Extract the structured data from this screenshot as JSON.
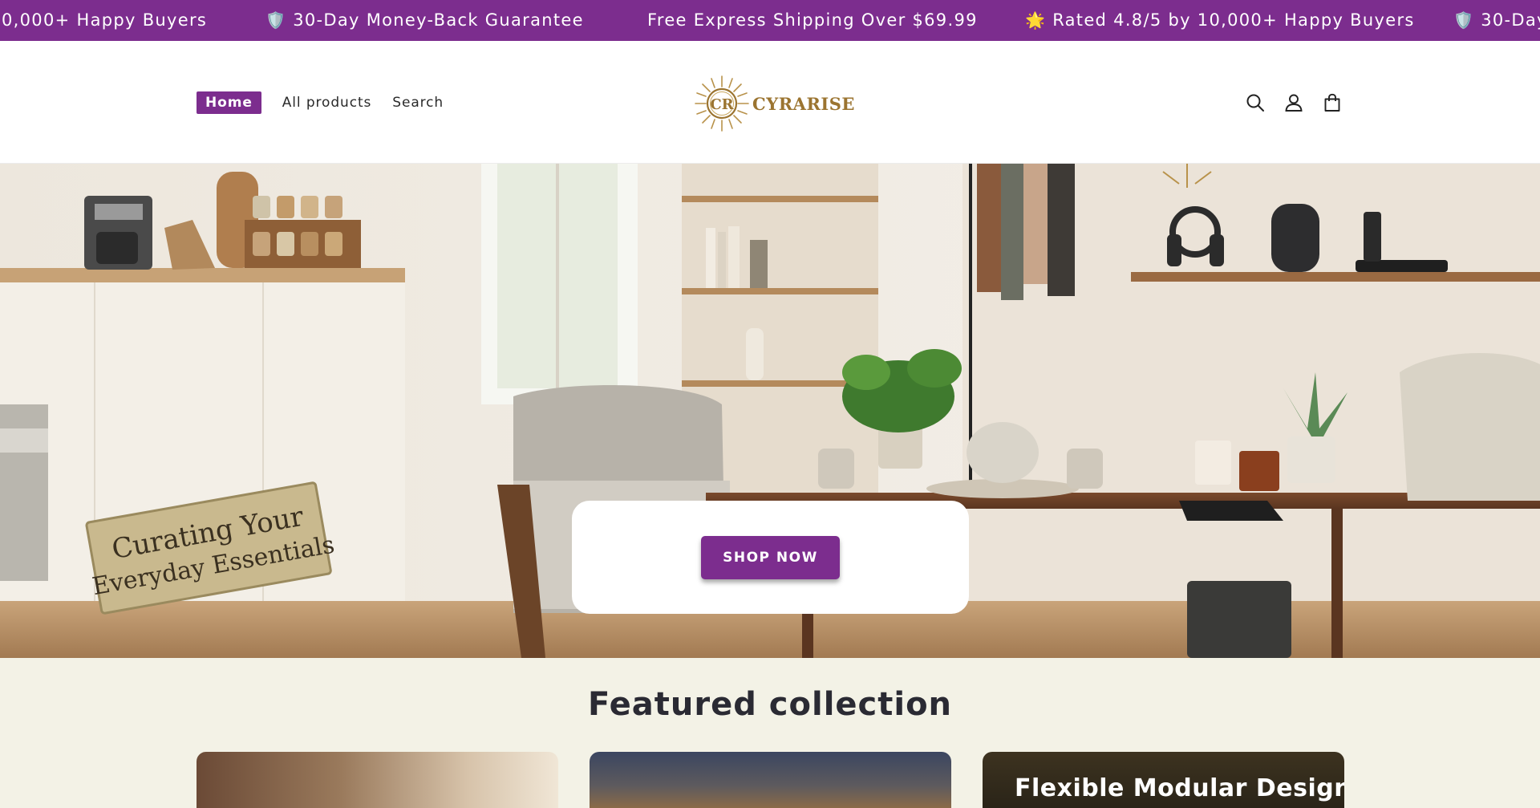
{
  "announcement": {
    "messages": [
      {
        "emoji": "",
        "text": "0,000+ Happy Buyers"
      },
      {
        "emoji": "🛡️",
        "text": "30-Day Money-Back Guarantee"
      },
      {
        "emoji": "",
        "text": "Free Express Shipping Over $69.99"
      },
      {
        "emoji": "🌟",
        "text": "Rated 4.8/5 by 10,000+ Happy Buyers"
      },
      {
        "emoji": "🛡️",
        "text": "30-Day"
      }
    ]
  },
  "header": {
    "nav": [
      {
        "label": "Home"
      },
      {
        "label": "All products"
      },
      {
        "label": "Search"
      }
    ],
    "logo": {
      "text": "CYRARISE"
    },
    "icons": [
      "search-icon",
      "account-icon",
      "cart-icon"
    ]
  },
  "hero": {
    "sign_text_line1": "Curating Your",
    "sign_text_line2": "Everyday Essentials",
    "button_label": "SHOP NOW"
  },
  "featured": {
    "title": "Featured collection",
    "cards": [
      {
        "caption": ""
      },
      {
        "caption": ""
      },
      {
        "caption": "Flexible Modular Design"
      }
    ]
  },
  "colors": {
    "accent": "#7c2d8e",
    "logo_gold": "#9b7430",
    "section_bg": "#f3f2e6"
  }
}
